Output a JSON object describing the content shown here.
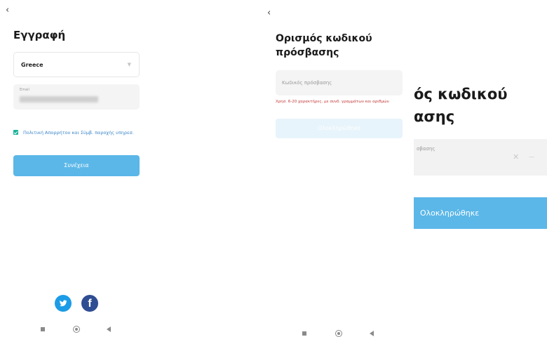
{
  "screen1": {
    "back_icon": "back-arrow-icon",
    "title": "Εγγραφή",
    "country_value": "Greece",
    "email_label": "Email",
    "terms_text": "Πολιτική Απορρήτου και Σύμβ. παροχής υπηρεσ.",
    "continue_label": "Συνέχεια",
    "social": [
      "twitter-icon",
      "facebook-icon"
    ],
    "facebook_glyph": "f"
  },
  "screen2": {
    "back_icon": "back-arrow-icon",
    "title": "Ορισμός κωδικού πρόσβασης",
    "password_placeholder": "Κωδικός πρόσβασης",
    "error_text": "Χρησ. 6-20 χαρακτήρες, με συνδ. γραμμάτων και αριθμών",
    "done_label": "Ολοκληρώθηκε"
  },
  "screen3": {
    "title_line1": "ός κωδικού",
    "title_line2": "ασης",
    "field_label": "σβασης",
    "done_label": "Ολοκληρώθηκε"
  },
  "colors": {
    "accent": "#5bb7e8",
    "accent_disabled": "#e7f4fb",
    "check": "#1bb39a",
    "link": "#3b85c8",
    "error": "#c23b3b",
    "twitter": "#1c9ce6",
    "facebook": "#2f4d92"
  }
}
